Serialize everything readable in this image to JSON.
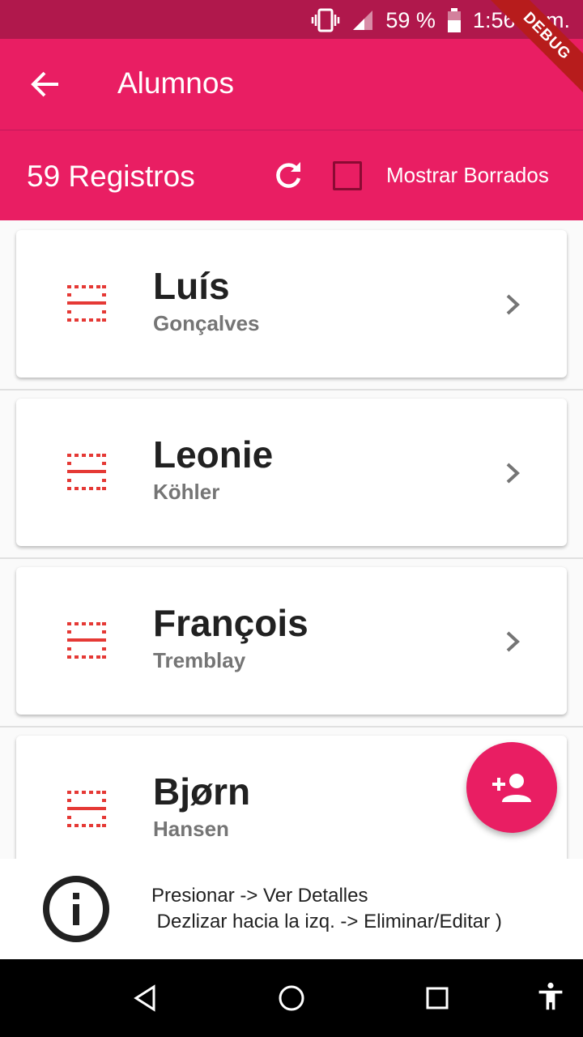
{
  "status_bar": {
    "battery": "59 %",
    "time": "1:56 p. m."
  },
  "debug_banner": "DEBUG",
  "app_bar": {
    "title": "Alumnos"
  },
  "toolbar": {
    "count_label": "59 Registros",
    "show_deleted_label": "Mostrar Borrados",
    "show_deleted_checked": false
  },
  "students": [
    {
      "first_name": "Luís",
      "last_name": "Gonçalves"
    },
    {
      "first_name": "Leonie",
      "last_name": "Köhler"
    },
    {
      "first_name": "François",
      "last_name": "Tremblay"
    },
    {
      "first_name": "Bjørn",
      "last_name": "Hansen"
    }
  ],
  "info": {
    "line1": "Presionar -> Ver Detalles",
    "line2": " Dezlizar hacia la izq. -> Eliminar/Editar )"
  },
  "colors": {
    "primary": "#e91e63",
    "status_bar": "#b0184c",
    "icon_accent": "#e53935"
  },
  "icons": {
    "back": "arrow-left-icon",
    "refresh": "refresh-icon",
    "student": "student-avatar-icon",
    "chevron": "chevron-right-icon",
    "add_user": "person-add-icon",
    "info": "info-icon"
  }
}
